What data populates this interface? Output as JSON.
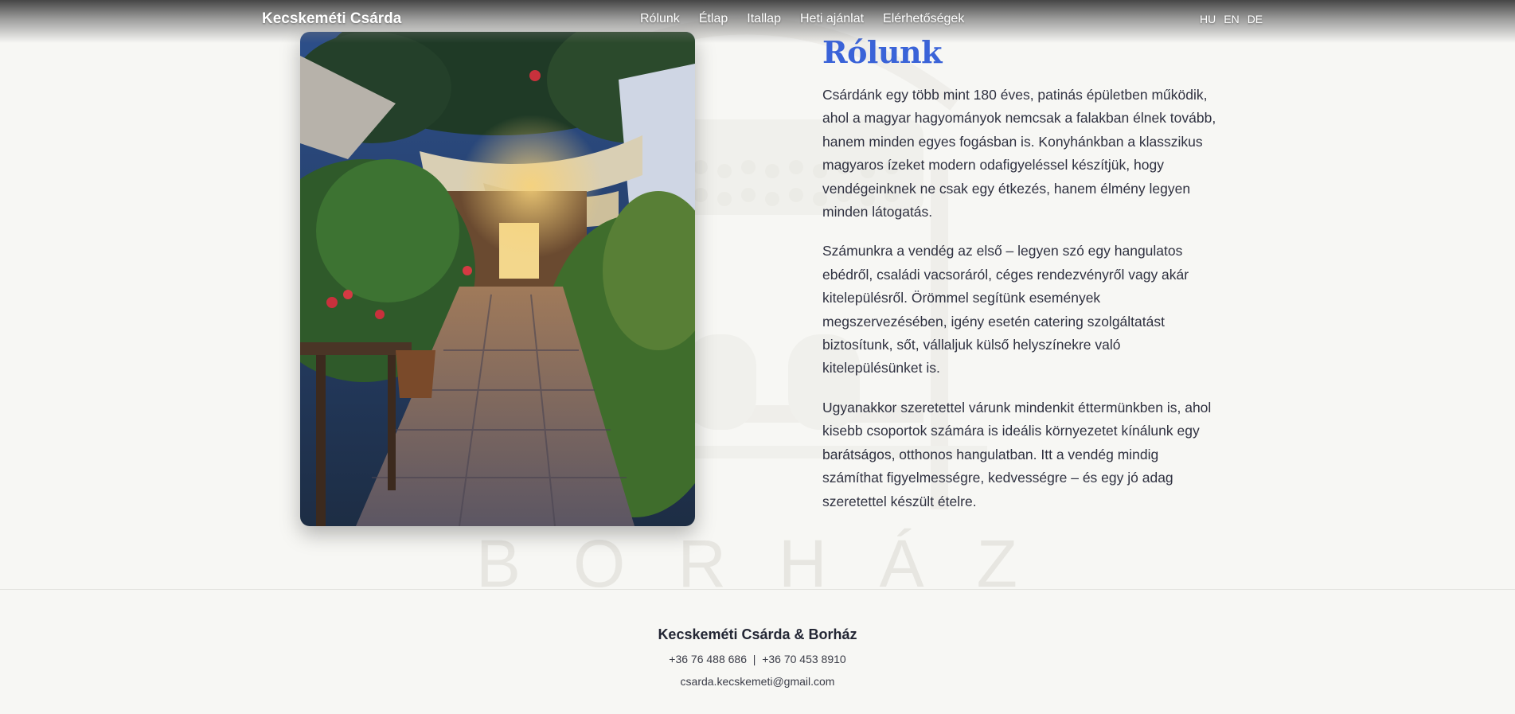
{
  "nav": {
    "brand": "Kecskeméti Csárda",
    "links": [
      "Rólunk",
      "Étlap",
      "Itallap",
      "Heti ajánlat",
      "Elérhetőségek"
    ],
    "languages": [
      "HU",
      "EN",
      "DE"
    ]
  },
  "watermark": {
    "letters": [
      "B",
      "O",
      "R",
      "H",
      "Á",
      "Z"
    ]
  },
  "about": {
    "title": "Rólunk",
    "paragraphs": [
      "Csárdánk egy több mint 180 éves, patinás épületben működik, ahol a magyar hagyományok nemcsak a falakban élnek tovább, hanem minden egyes fogásban is. Konyhánkban a klasszikus magyaros ízeket modern odafigyeléssel készítjük, hogy vendégeinknek ne csak egy étkezés, hanem élmény legyen minden látogatás.",
      "Számunkra a vendég az első – legyen szó egy hangulatos ebédről, családi vacsoráról, céges rendezvényről vagy akár kitelepülésről. Örömmel segítünk események megszervezésében, igény esetén catering szolgáltatást biztosítunk, sőt, vállaljuk külső helyszínekre való kitelepülésünket is.",
      "Ugyanakkor szeretettel várunk mindenkit éttermünkben is, ahol kisebb csoportok számára is ideális környezetet kínálunk egy barátságos, otthonos hangulatban. Itt a vendég mindig számíthat figyelmességre, kedvességre – és egy jó adag szeretettel készült ételre."
    ]
  },
  "footer": {
    "name": "Kecskeméti Csárda & Borház",
    "phone1": "+36 76 488 686",
    "separator": "|",
    "phone2": "+36 70 453 8910",
    "email": "csarda.kecskemeti@gmail.com"
  },
  "colors": {
    "accent": "#3a63d8",
    "background": "#f7f7f4",
    "text": "#2f3140"
  }
}
